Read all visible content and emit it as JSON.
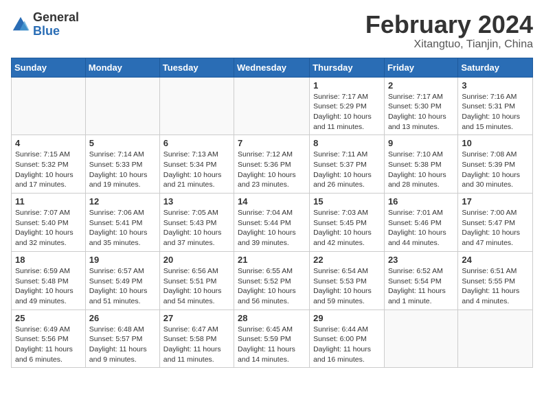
{
  "header": {
    "logo_general": "General",
    "logo_blue": "Blue",
    "month_year": "February 2024",
    "location": "Xitangtuo, Tianjin, China"
  },
  "weekdays": [
    "Sunday",
    "Monday",
    "Tuesday",
    "Wednesday",
    "Thursday",
    "Friday",
    "Saturday"
  ],
  "weeks": [
    [
      {
        "day": "",
        "info": ""
      },
      {
        "day": "",
        "info": ""
      },
      {
        "day": "",
        "info": ""
      },
      {
        "day": "",
        "info": ""
      },
      {
        "day": "1",
        "info": "Sunrise: 7:17 AM\nSunset: 5:29 PM\nDaylight: 10 hours\nand 11 minutes."
      },
      {
        "day": "2",
        "info": "Sunrise: 7:17 AM\nSunset: 5:30 PM\nDaylight: 10 hours\nand 13 minutes."
      },
      {
        "day": "3",
        "info": "Sunrise: 7:16 AM\nSunset: 5:31 PM\nDaylight: 10 hours\nand 15 minutes."
      }
    ],
    [
      {
        "day": "4",
        "info": "Sunrise: 7:15 AM\nSunset: 5:32 PM\nDaylight: 10 hours\nand 17 minutes."
      },
      {
        "day": "5",
        "info": "Sunrise: 7:14 AM\nSunset: 5:33 PM\nDaylight: 10 hours\nand 19 minutes."
      },
      {
        "day": "6",
        "info": "Sunrise: 7:13 AM\nSunset: 5:34 PM\nDaylight: 10 hours\nand 21 minutes."
      },
      {
        "day": "7",
        "info": "Sunrise: 7:12 AM\nSunset: 5:36 PM\nDaylight: 10 hours\nand 23 minutes."
      },
      {
        "day": "8",
        "info": "Sunrise: 7:11 AM\nSunset: 5:37 PM\nDaylight: 10 hours\nand 26 minutes."
      },
      {
        "day": "9",
        "info": "Sunrise: 7:10 AM\nSunset: 5:38 PM\nDaylight: 10 hours\nand 28 minutes."
      },
      {
        "day": "10",
        "info": "Sunrise: 7:08 AM\nSunset: 5:39 PM\nDaylight: 10 hours\nand 30 minutes."
      }
    ],
    [
      {
        "day": "11",
        "info": "Sunrise: 7:07 AM\nSunset: 5:40 PM\nDaylight: 10 hours\nand 32 minutes."
      },
      {
        "day": "12",
        "info": "Sunrise: 7:06 AM\nSunset: 5:41 PM\nDaylight: 10 hours\nand 35 minutes."
      },
      {
        "day": "13",
        "info": "Sunrise: 7:05 AM\nSunset: 5:43 PM\nDaylight: 10 hours\nand 37 minutes."
      },
      {
        "day": "14",
        "info": "Sunrise: 7:04 AM\nSunset: 5:44 PM\nDaylight: 10 hours\nand 39 minutes."
      },
      {
        "day": "15",
        "info": "Sunrise: 7:03 AM\nSunset: 5:45 PM\nDaylight: 10 hours\nand 42 minutes."
      },
      {
        "day": "16",
        "info": "Sunrise: 7:01 AM\nSunset: 5:46 PM\nDaylight: 10 hours\nand 44 minutes."
      },
      {
        "day": "17",
        "info": "Sunrise: 7:00 AM\nSunset: 5:47 PM\nDaylight: 10 hours\nand 47 minutes."
      }
    ],
    [
      {
        "day": "18",
        "info": "Sunrise: 6:59 AM\nSunset: 5:48 PM\nDaylight: 10 hours\nand 49 minutes."
      },
      {
        "day": "19",
        "info": "Sunrise: 6:57 AM\nSunset: 5:49 PM\nDaylight: 10 hours\nand 51 minutes."
      },
      {
        "day": "20",
        "info": "Sunrise: 6:56 AM\nSunset: 5:51 PM\nDaylight: 10 hours\nand 54 minutes."
      },
      {
        "day": "21",
        "info": "Sunrise: 6:55 AM\nSunset: 5:52 PM\nDaylight: 10 hours\nand 56 minutes."
      },
      {
        "day": "22",
        "info": "Sunrise: 6:54 AM\nSunset: 5:53 PM\nDaylight: 10 hours\nand 59 minutes."
      },
      {
        "day": "23",
        "info": "Sunrise: 6:52 AM\nSunset: 5:54 PM\nDaylight: 11 hours\nand 1 minute."
      },
      {
        "day": "24",
        "info": "Sunrise: 6:51 AM\nSunset: 5:55 PM\nDaylight: 11 hours\nand 4 minutes."
      }
    ],
    [
      {
        "day": "25",
        "info": "Sunrise: 6:49 AM\nSunset: 5:56 PM\nDaylight: 11 hours\nand 6 minutes."
      },
      {
        "day": "26",
        "info": "Sunrise: 6:48 AM\nSunset: 5:57 PM\nDaylight: 11 hours\nand 9 minutes."
      },
      {
        "day": "27",
        "info": "Sunrise: 6:47 AM\nSunset: 5:58 PM\nDaylight: 11 hours\nand 11 minutes."
      },
      {
        "day": "28",
        "info": "Sunrise: 6:45 AM\nSunset: 5:59 PM\nDaylight: 11 hours\nand 14 minutes."
      },
      {
        "day": "29",
        "info": "Sunrise: 6:44 AM\nSunset: 6:00 PM\nDaylight: 11 hours\nand 16 minutes."
      },
      {
        "day": "",
        "info": ""
      },
      {
        "day": "",
        "info": ""
      }
    ]
  ]
}
